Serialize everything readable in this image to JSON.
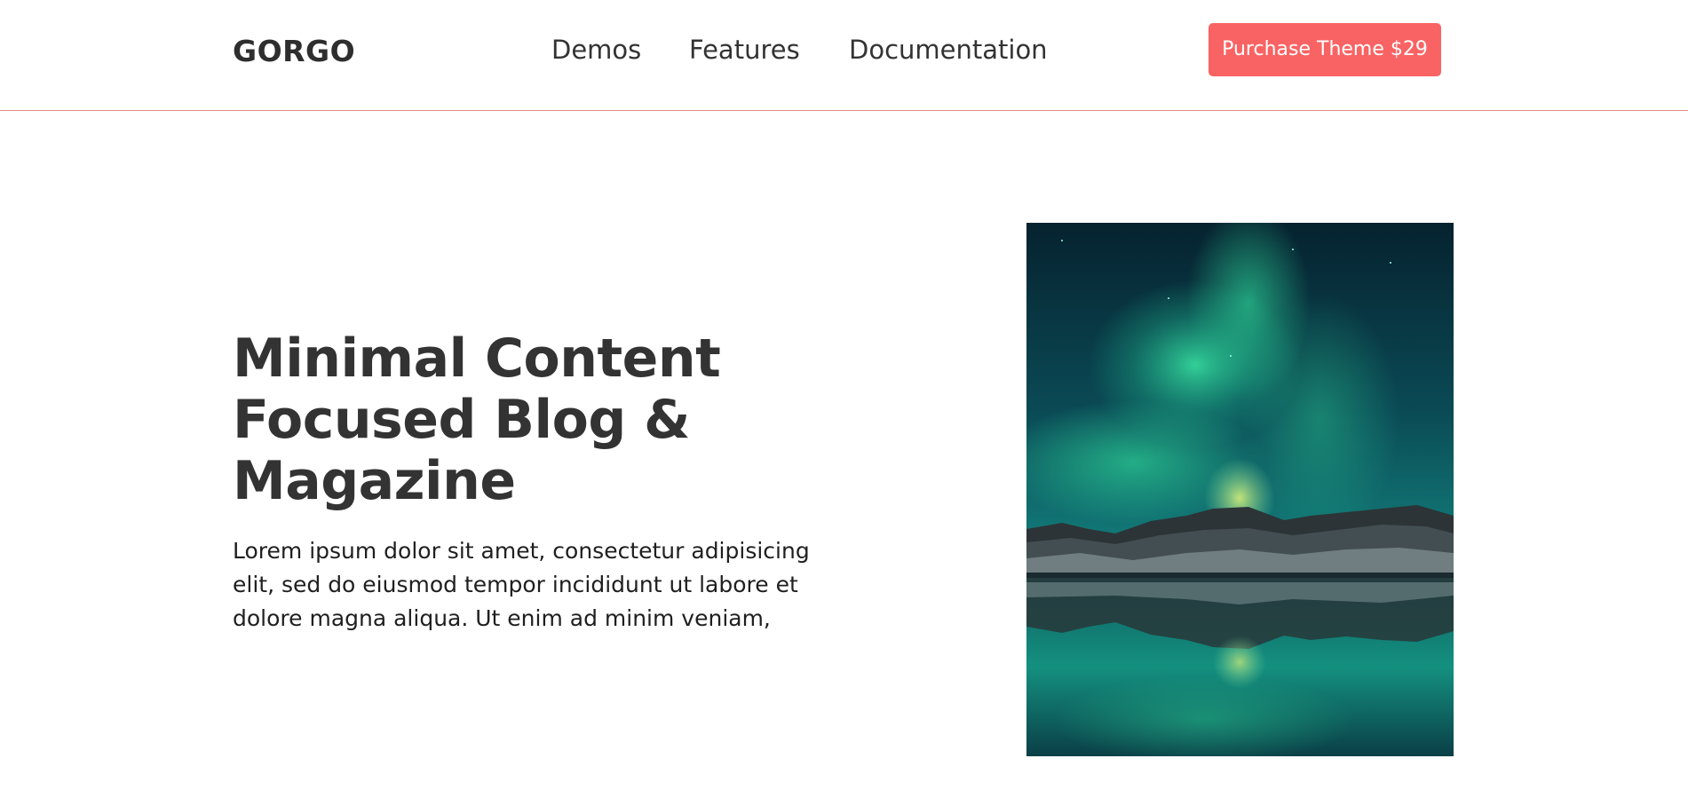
{
  "header": {
    "logo": "GORGO",
    "nav": [
      {
        "label": "Demos"
      },
      {
        "label": "Features"
      },
      {
        "label": "Documentation"
      }
    ],
    "purchase_label": "Purchase Theme $29",
    "accent_color": "#fa6363"
  },
  "hero": {
    "title": "Minimal Content Focused Blog & Magazine",
    "text": "Lorem ipsum dolor sit amet, consectetur adipisicing elit, sed do eiusmod tempor incididunt ut labore et dolore magna aliqua. Ut enim ad minim veniam,",
    "image": {
      "icon": "aurora-mountain-lake-photo"
    }
  }
}
